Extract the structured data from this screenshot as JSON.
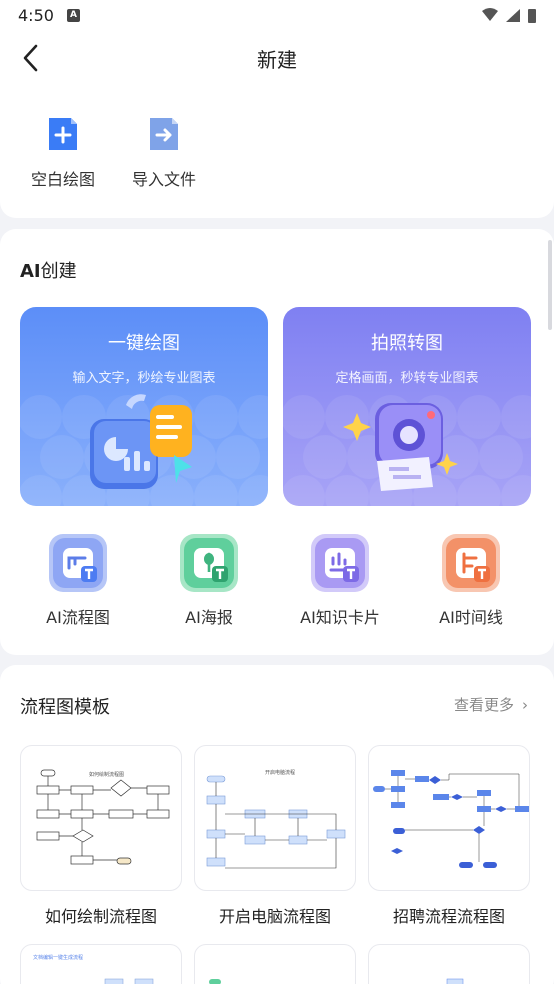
{
  "status": {
    "time": "4:50",
    "notif": "A"
  },
  "header": {
    "title": "新建"
  },
  "quick_actions": [
    {
      "label": "空白绘图",
      "icon": "add-file-icon"
    },
    {
      "label": "导入文件",
      "icon": "import-file-icon"
    }
  ],
  "ai": {
    "title_bold": "AI",
    "title_rest": "创建",
    "banners": [
      {
        "title": "一键绘图",
        "subtitle": "输入文字，秒绘专业图表"
      },
      {
        "title": "拍照转图",
        "subtitle": "定格画面，秒转专业图表"
      }
    ],
    "tools": [
      {
        "label": "AI流程图",
        "icon": "ai-flowchart-icon"
      },
      {
        "label": "AI海报",
        "icon": "ai-poster-icon"
      },
      {
        "label": "AI知识卡片",
        "icon": "ai-knowledge-card-icon"
      },
      {
        "label": "AI时间线",
        "icon": "ai-timeline-icon"
      }
    ]
  },
  "templates": {
    "title": "流程图模板",
    "more": "查看更多",
    "items": [
      {
        "label": "如何绘制流程图",
        "thumb_title": "如何绘制流程图"
      },
      {
        "label": "开启电脑流程图",
        "thumb_title": "开启电脑流程"
      },
      {
        "label": "招聘流程流程图"
      }
    ],
    "second_row_caption": "文档编辑一键生成流程"
  },
  "colors": {
    "accent_blue": "#5c8ef8",
    "accent_purple": "#7f80f2",
    "tool_blue": "#8ea6f4",
    "tool_green": "#5fcf9c",
    "tool_purple": "#a99af3",
    "tool_orange": "#f39168"
  }
}
